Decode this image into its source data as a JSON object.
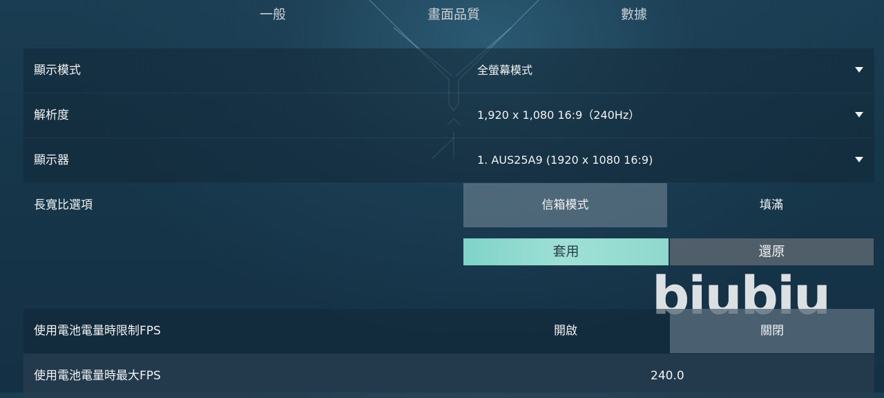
{
  "tabs": [
    "一般",
    "畫面品質",
    "數據"
  ],
  "settings": {
    "display_mode": {
      "label": "顯示模式",
      "value": "全螢幕模式"
    },
    "resolution": {
      "label": "解析度",
      "value": "1,920 x 1,080 16:9（240Hz）"
    },
    "monitor": {
      "label": "顯示器",
      "value": "1. AUS25A9 (1920 x  1080 16:9)"
    },
    "aspect": {
      "label": "長寬比選項",
      "options": [
        "信箱模式",
        "填滿"
      ],
      "selected": "信箱模式"
    },
    "apply_label": "套用",
    "reset_label": "還原",
    "limit_fps_battery": {
      "label": "使用電池電量時限制FPS",
      "options": [
        "開啟",
        "關閉"
      ],
      "selected": "關閉"
    },
    "max_fps_battery": {
      "label": "使用電池電量時最大FPS",
      "value": "240.0"
    }
  },
  "watermark": "biubiu",
  "colors": {
    "accent": "#8fd8cd",
    "panel": "#12283a",
    "selected": "#78899a"
  },
  "icons": [
    "dropdown-caret-icon"
  ]
}
